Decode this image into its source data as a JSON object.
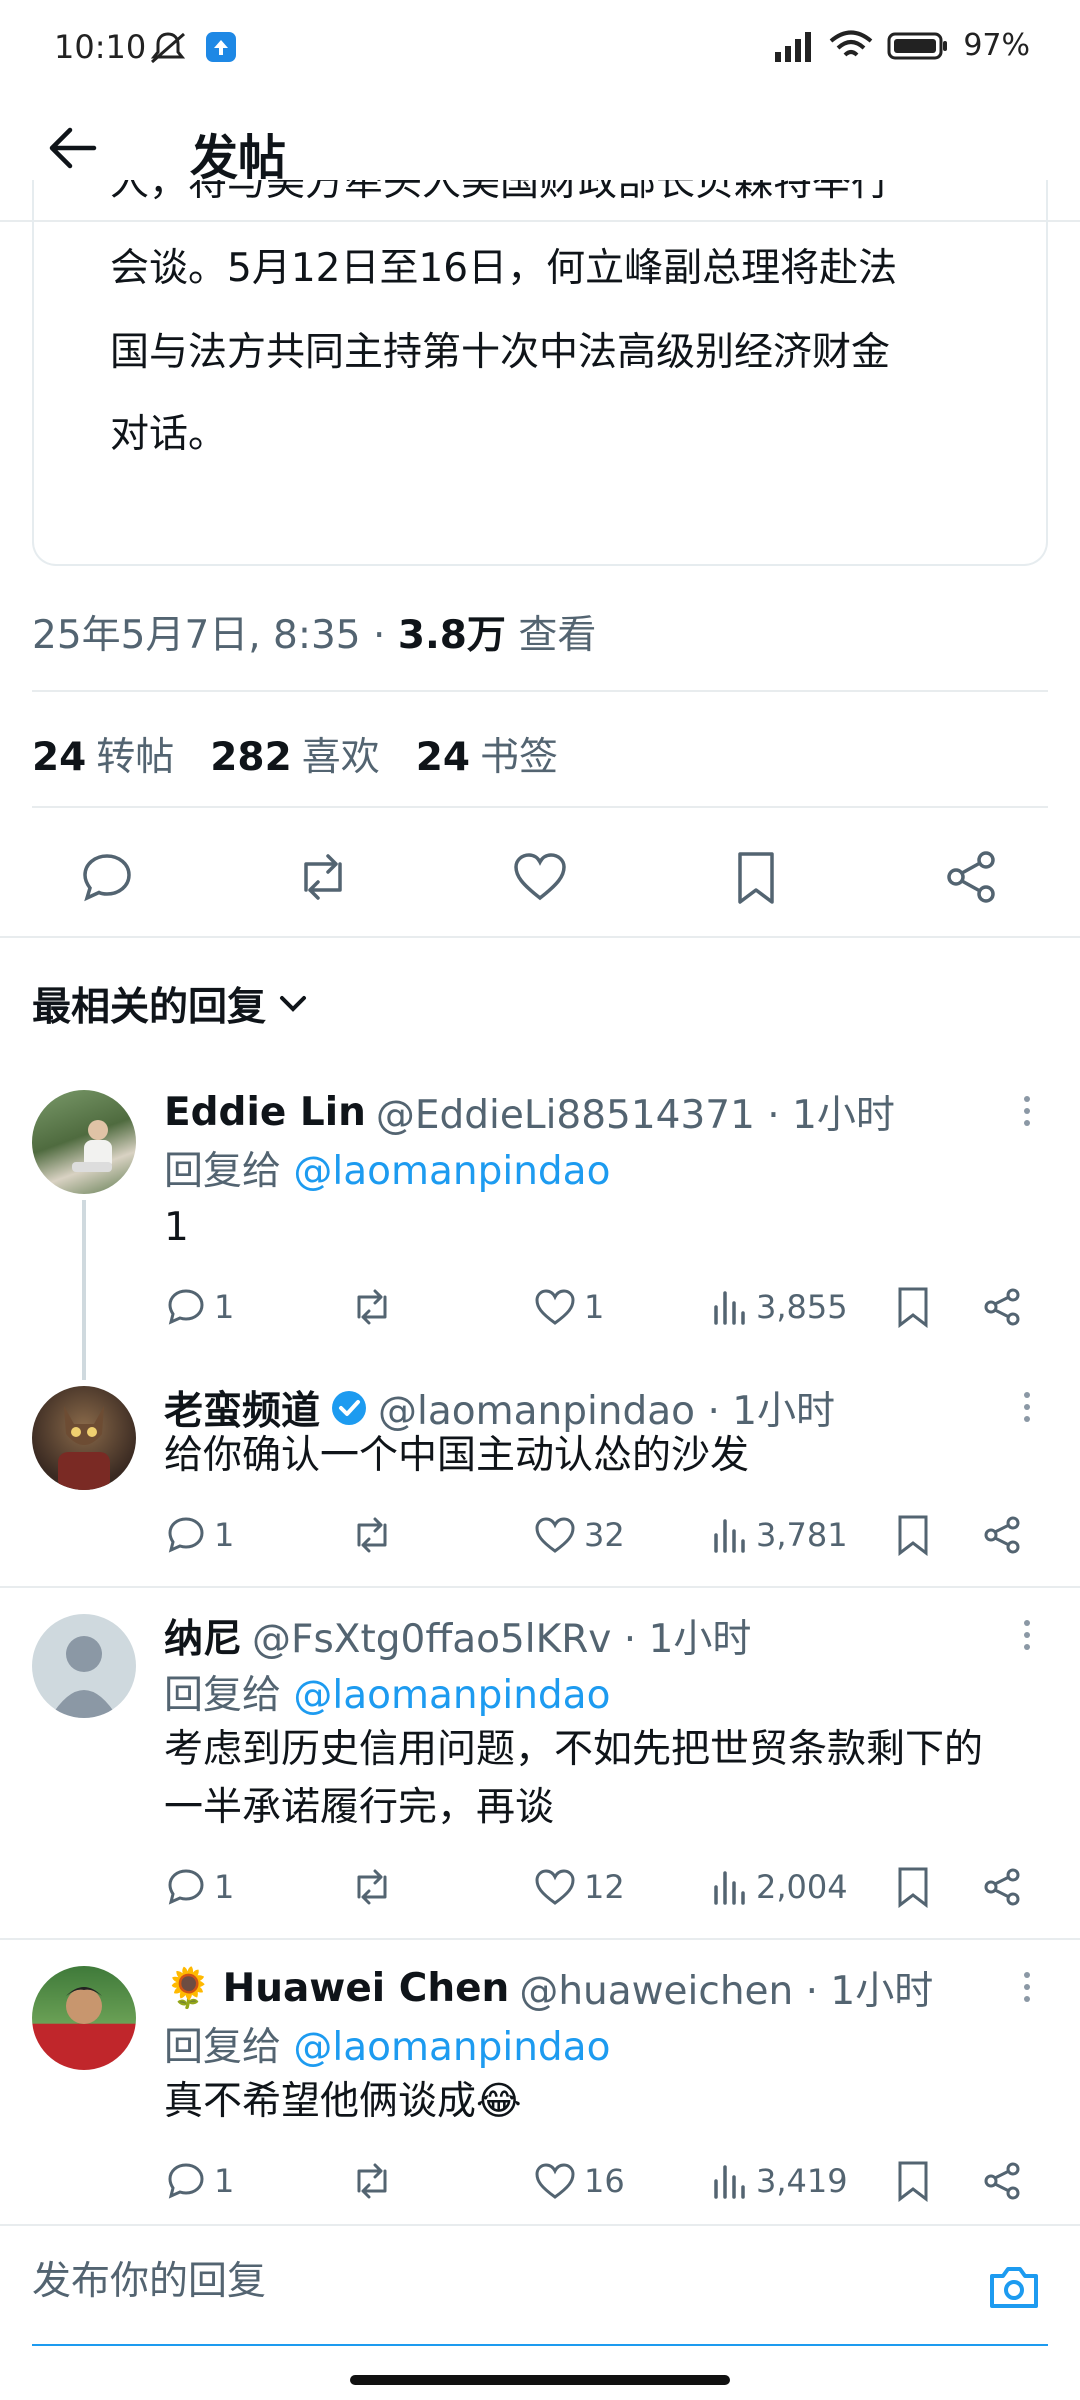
{
  "status_bar": {
    "time": "10:10",
    "battery": "97%"
  },
  "header": {
    "title": "发帖"
  },
  "quoted": {
    "line1": "人，将与美方牵头人美国财政部长贝森特举行",
    "line2": "会谈。5月12日至16日，何立峰副总理将赴法",
    "line3": "国与法方共同主持第十次中法高级别经济财金",
    "line4": "对话。"
  },
  "meta": {
    "date": "25年5月7日, 8:35 · ",
    "views_count": "3.8万",
    "views_label": " 查看"
  },
  "stats": {
    "reposts_count": "24",
    "reposts_label": "转帖",
    "likes_count": "282",
    "likes_label": "喜欢",
    "bookmarks_count": "24",
    "bookmarks_label": "书签"
  },
  "sort_label": "最相关的回复",
  "replies": [
    {
      "name": "Eddie Lin",
      "handle": "@EddieLi88514371 · 1小时",
      "reply_to_prefix": "回复给 ",
      "reply_to_user": "@laomanpindao",
      "text": "1",
      "comments": "1",
      "likes": "1",
      "views": "3,855"
    },
    {
      "name": "老蛮频道",
      "handle": "@laomanpindao · 1小时",
      "text": "给你确认一个中国主动认怂的沙发",
      "comments": "1",
      "likes": "32",
      "views": "3,781"
    },
    {
      "name": "纳尼",
      "handle": "@FsXtg0ffao5lKRv · 1小时",
      "reply_to_prefix": "回复给 ",
      "reply_to_user": "@laomanpindao",
      "text_line1": "考虑到历史信用问题，不如先把世贸条款剩下的",
      "text_line2": "一半承诺履行完，再谈",
      "comments": "1",
      "likes": "12",
      "views": "2,004"
    },
    {
      "emoji": "🌻",
      "name": "Huawei Chen",
      "handle": "@huaweichen · 1小时",
      "reply_to_prefix": "回复给 ",
      "reply_to_user": "@laomanpindao",
      "text": "真不希望他俩谈成😂",
      "comments": "1",
      "likes": "16",
      "views": "3,419"
    }
  ],
  "compose_placeholder": "发布你的回复",
  "colors": {
    "link": "#1d9bf0",
    "verified": "#1d9bf0",
    "secondary_text": "#536471"
  }
}
